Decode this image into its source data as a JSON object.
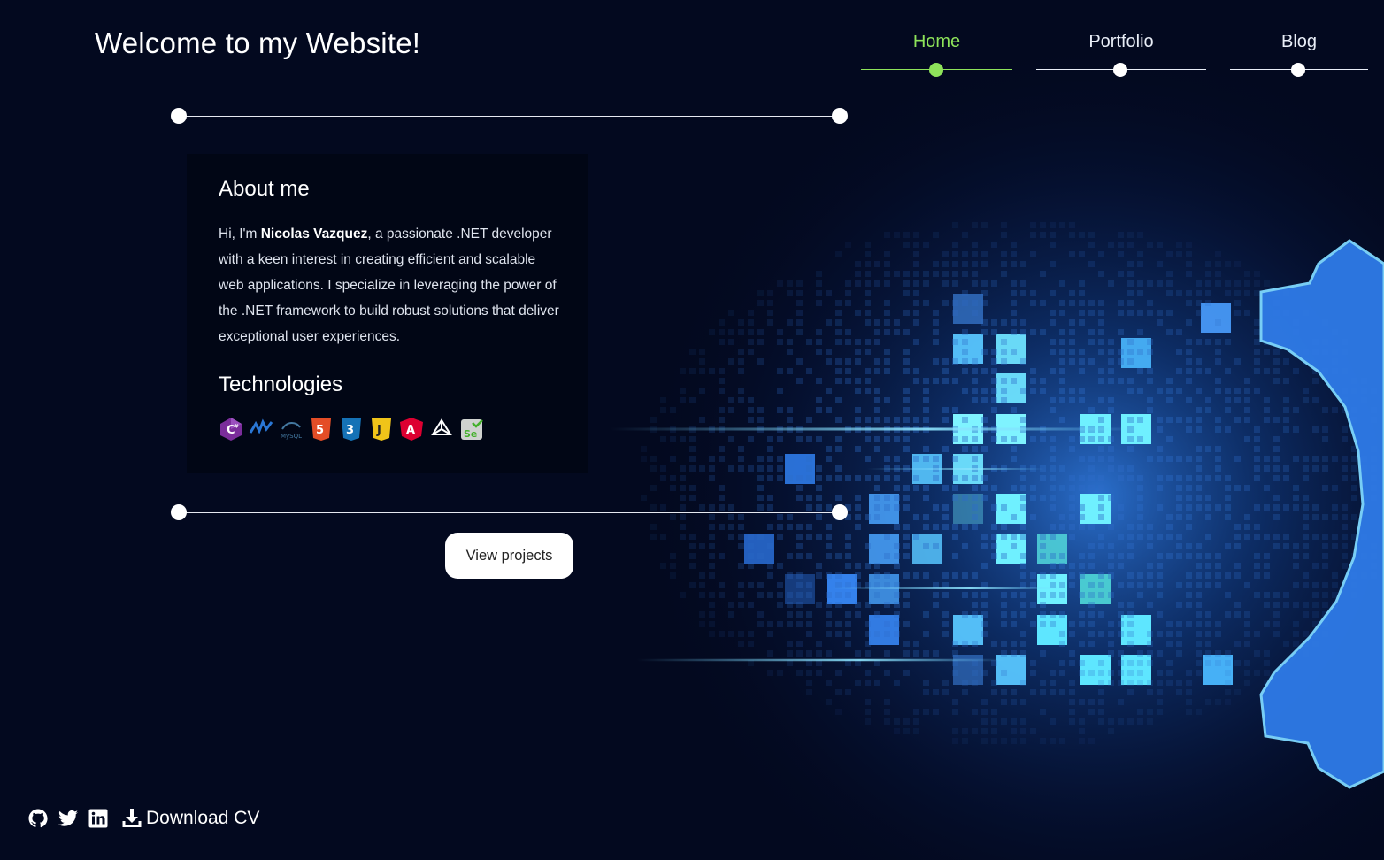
{
  "header": {
    "title": "Welcome to my Website!"
  },
  "nav": {
    "items": [
      {
        "label": "Home",
        "active": true
      },
      {
        "label": "Portfolio",
        "active": false
      },
      {
        "label": "Blog",
        "active": false
      }
    ],
    "active_color": "#8ee35a"
  },
  "about": {
    "heading": "About me",
    "text_before": "Hi, I'm ",
    "name": "Nicolas Vazquez",
    "text_after": ", a passionate .NET developer with a keen interest in creating efficient and scalable web applications. I specialize in leveraging the power of the .NET framework to build robust solutions that deliver exceptional user experiences."
  },
  "technologies": {
    "heading": "Technologies",
    "icons": [
      "csharp-icon",
      "dotnet-icon",
      "mysql-icon",
      "html5-icon",
      "css3-icon",
      "javascript-icon",
      "angular-icon",
      "unity-icon",
      "selenium-icon"
    ]
  },
  "cta": {
    "label": "View projects"
  },
  "footer": {
    "icons": [
      "github-icon",
      "twitter-icon",
      "linkedin-icon",
      "download-icon"
    ],
    "download_label": "Download CV"
  },
  "colors": {
    "background": "#03091f",
    "accent_green": "#8ee35a",
    "tile_cyan": "#5ef2ff",
    "tile_blue": "#3a8dff"
  }
}
